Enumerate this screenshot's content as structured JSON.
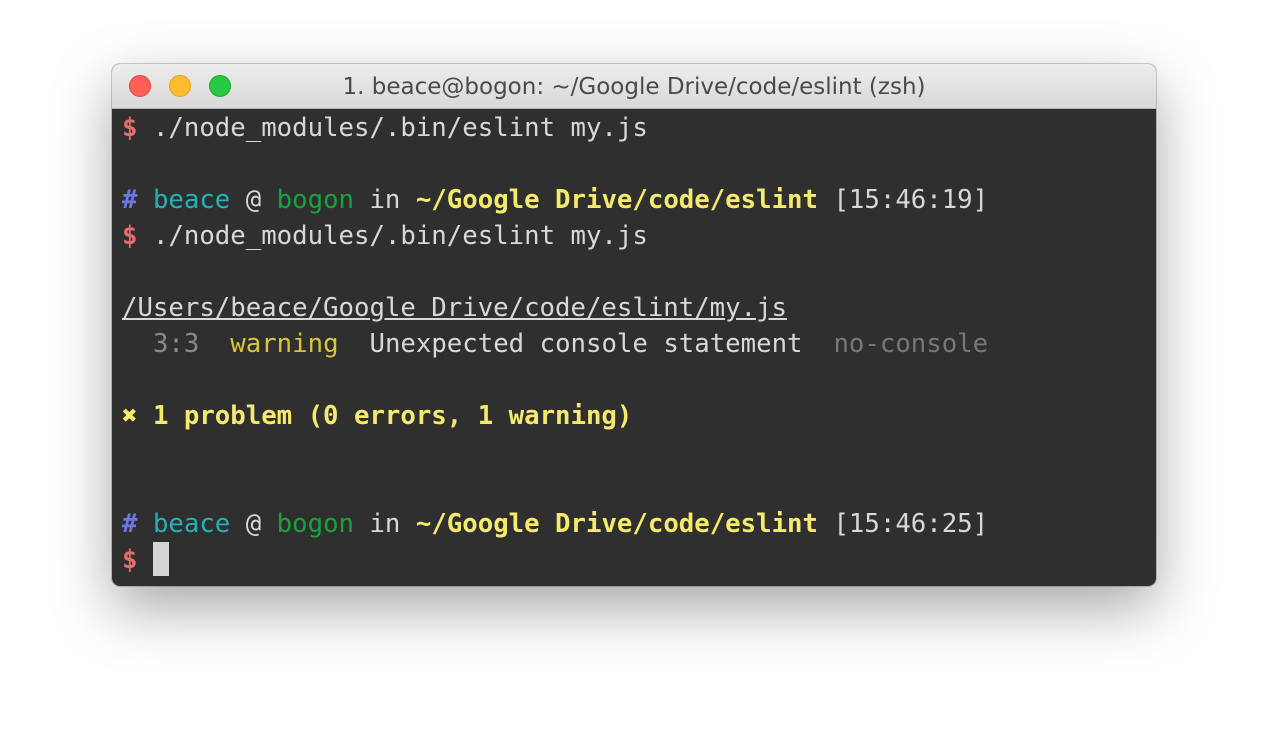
{
  "window": {
    "title": "1. beace@bogon: ~/Google Drive/code/eslint (zsh)"
  },
  "prompt": {
    "dollar": "$",
    "hash": "#",
    "user": "beace",
    "at": "@",
    "host": "bogon",
    "in": "in",
    "path": "~/Google Drive/code/eslint"
  },
  "lines": {
    "cmd1": "./node_modules/.bin/eslint my.js",
    "time1": "[15:46:19]",
    "cmd2": "./node_modules/.bin/eslint my.js",
    "file": "/Users/beace/Google Drive/code/eslint/my.js",
    "location": "3:3",
    "severity": "warning",
    "message": "Unexpected console statement",
    "rule": "no-console",
    "summary_icon": "✖",
    "summary": "1 problem (0 errors, 1 warning)",
    "time2": "[15:46:25]"
  },
  "icons": {
    "close": "close-icon",
    "minimize": "minimize-icon",
    "zoom": "zoom-icon"
  },
  "colors": {
    "background": "#2f2f2f",
    "dollar": "#e76c6c",
    "hash": "#6b78e6",
    "user": "#24b2b8",
    "host": "#17a33b",
    "path": "#f6ea6c",
    "warning": "#d8c538",
    "rule": "#777777"
  }
}
